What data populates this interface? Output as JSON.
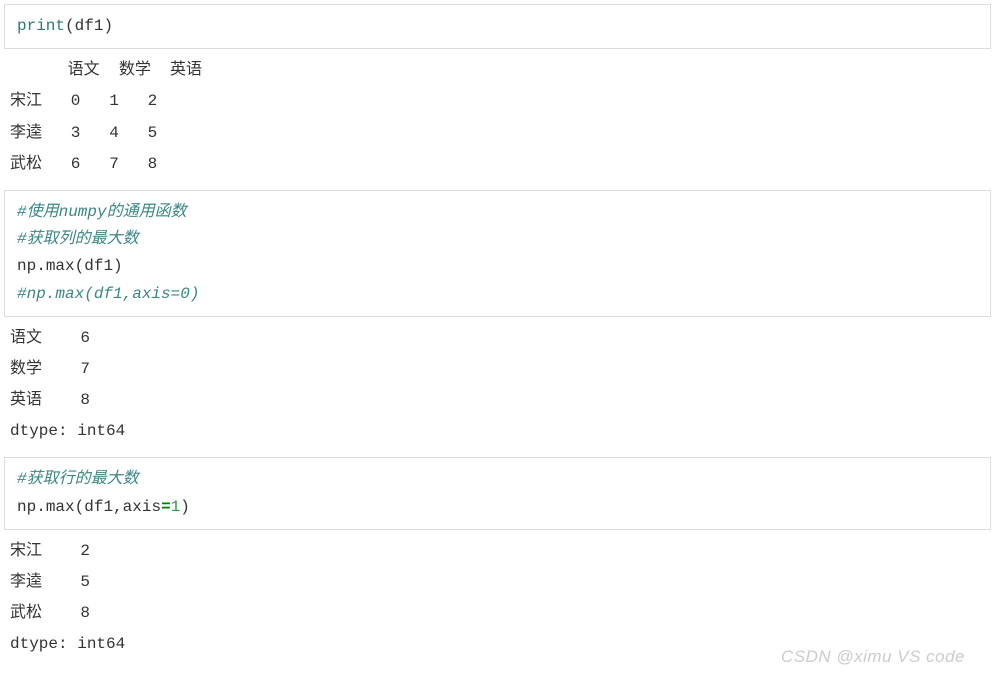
{
  "cell1": {
    "line1_fn": "print",
    "line1_open": "(",
    "line1_arg": "df1",
    "line1_close": ")"
  },
  "output1": "      语文  数学  英语\n宋江   0   1   2\n李逵   3   4   5\n武松   6   7   8",
  "cell2": {
    "comment1": "#使用numpy的通用函数",
    "comment2": "#获取列的最大数",
    "line3_obj": "np",
    "line3_dot": ".",
    "line3_fn": "max",
    "line3_open": "(",
    "line3_arg": "df1",
    "line3_close": ")",
    "comment3": "#np.max(df1,axis=0)"
  },
  "output2": "语文    6\n数学    7\n英语    8\ndtype: int64",
  "cell3": {
    "comment1": "#获取行的最大数",
    "line2_obj": "np",
    "line2_dot": ".",
    "line2_fn": "max",
    "line2_open": "(",
    "line2_arg1": "df1",
    "line2_comma": ",",
    "line2_kw": "axis",
    "line2_eq": "=",
    "line2_num": "1",
    "line2_close": ")"
  },
  "output3": "宋江    2\n李逵    5\n武松    8\ndtype: int64",
  "watermark": "CSDN @ximu VS code"
}
